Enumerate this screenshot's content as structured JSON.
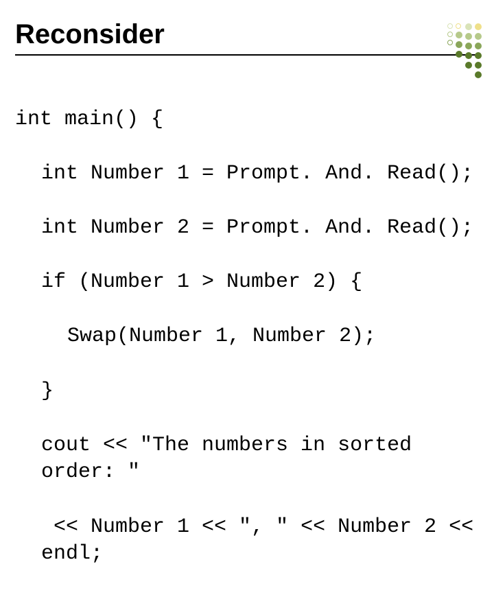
{
  "title": "Reconsider",
  "code": {
    "l1": "int main() {",
    "l2": "int Number 1 = Prompt. And. Read();",
    "l3": "int Number 2 = Prompt. And. Read();",
    "l4": "if (Number 1 > Number 2) {",
    "l5": "Swap(Number 1, Number 2);",
    "l6": "}",
    "l7": "cout << \"The numbers in sorted order: \"",
    "l8": " << Number 1 << \", \" << Number 2 << endl;"
  },
  "decoration": {
    "colors": [
      "#5a7a2a",
      "#8aa65a",
      "#b6c98a",
      "#d9e3b8",
      "#efe08a"
    ]
  }
}
